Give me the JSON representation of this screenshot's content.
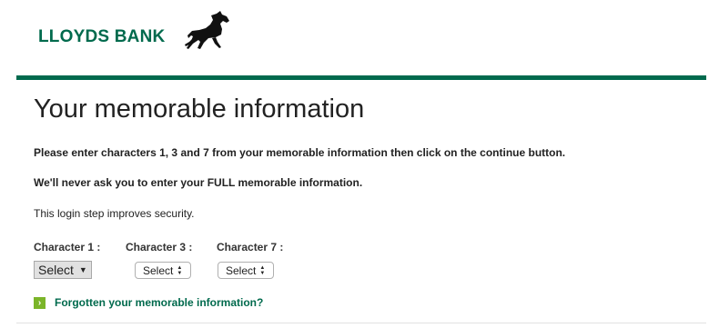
{
  "brand": {
    "name": "LLOYDS BANK",
    "logo_icon": "horse-icon",
    "color": "#006a4d"
  },
  "page": {
    "title": "Your memorable information",
    "instruction": "Please enter characters 1, 3 and 7 from your memorable information then click on the continue button.",
    "warning": "We'll never ask you to enter your FULL memorable information.",
    "note": "This login step improves security."
  },
  "characters": [
    {
      "label": "Character 1 :",
      "selected": "Select"
    },
    {
      "label": "Character 3 :",
      "selected": "Select"
    },
    {
      "label": "Character 7 :",
      "selected": "Select"
    }
  ],
  "forgot_link": {
    "label": "Forgotten your memorable information?",
    "icon": "chevron-right-icon",
    "icon_color": "#7bb529"
  }
}
